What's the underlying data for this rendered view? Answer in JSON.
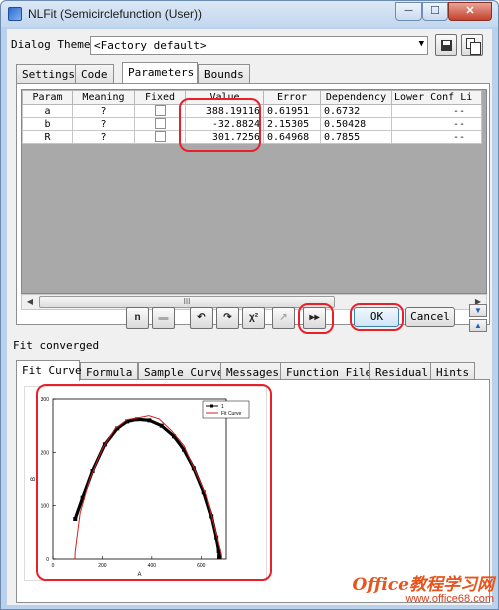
{
  "window": {
    "title": "NLFit (Semicirclefunction (User))",
    "controls": [
      "minimize-icon",
      "maximize-icon",
      "close-icon"
    ]
  },
  "theme": {
    "label": "Dialog Theme",
    "value": "<Factory default>"
  },
  "top_tabs": [
    {
      "label": "Settings",
      "active": false
    },
    {
      "label": "Code",
      "active": false
    },
    {
      "label": "Parameters",
      "active": true
    },
    {
      "label": "Bounds",
      "active": false
    }
  ],
  "params_table": {
    "headers": [
      "Param",
      "Meaning",
      "Fixed",
      "Value",
      "Error",
      "Dependency",
      "Lower Conf Li"
    ],
    "rows": [
      {
        "param": "a",
        "meaning": "?",
        "fixed": false,
        "value": "388.19116",
        "error": "0.61951",
        "dependency": "0.6732",
        "lcl": "--"
      },
      {
        "param": "b",
        "meaning": "?",
        "fixed": false,
        "value": "-32.8824",
        "error": "2.15305",
        "dependency": "0.50428",
        "lcl": "--"
      },
      {
        "param": "R",
        "meaning": "?",
        "fixed": false,
        "value": "301.7256",
        "error": "0.64968",
        "dependency": "0.7855",
        "lcl": "--"
      }
    ]
  },
  "scrollbar": {
    "thumb_glyph": "III"
  },
  "toolbar": {
    "buttons": [
      {
        "name": "iterations-icon",
        "glyph": "n",
        "enabled": true
      },
      {
        "name": "save-icon",
        "glyph": "▬",
        "enabled": false
      },
      {
        "name": "undo-icon",
        "glyph": "↶",
        "enabled": true
      },
      {
        "name": "redo-icon",
        "glyph": "↷",
        "enabled": true
      },
      {
        "name": "chi-square-icon",
        "glyph": "χ²",
        "enabled": true
      },
      {
        "name": "one-iteration-icon",
        "glyph": "↗",
        "enabled": false
      },
      {
        "name": "fit-till-converge-icon",
        "glyph": "▸▸",
        "enabled": true
      }
    ],
    "ok_label": "OK",
    "cancel_label": "Cancel"
  },
  "status": "Fit converged",
  "bottom_tabs": [
    {
      "label": "Fit Curve",
      "active": true
    },
    {
      "label": "Formula",
      "active": false
    },
    {
      "label": "Sample Curve",
      "active": false
    },
    {
      "label": "Messages",
      "active": false
    },
    {
      "label": "Function File",
      "active": false
    },
    {
      "label": "Residual",
      "active": false
    },
    {
      "label": "Hints",
      "active": false
    }
  ],
  "chart_data": {
    "type": "line",
    "xlabel": "A",
    "ylabel": "B",
    "xlim": [
      0,
      700
    ],
    "ylim": [
      0,
      300
    ],
    "xticks": [
      "0",
      "200",
      "400",
      "600"
    ],
    "yticks": [
      "0",
      "100",
      "200",
      "300"
    ],
    "legend": {
      "position": "top-right",
      "entries": [
        "1",
        "Fit Curve"
      ]
    },
    "series": [
      {
        "name": "1",
        "style": "black-square-markers",
        "color": "#000000",
        "x": [
          90,
          120,
          160,
          210,
          260,
          300,
          340,
          390,
          440,
          490,
          530,
          570,
          610,
          640,
          660,
          670,
          672,
          672
        ],
        "y": [
          75,
          115,
          165,
          215,
          245,
          258,
          262,
          260,
          250,
          230,
          205,
          170,
          125,
          80,
          40,
          15,
          5,
          0
        ]
      },
      {
        "name": "Fit Curve",
        "style": "solid-line",
        "color": "#d32020",
        "x": [
          86.47,
          90,
          110,
          150,
          200,
          250,
          300,
          350,
          388.19,
          430,
          480,
          530,
          580,
          620,
          660,
          680,
          689.9
        ],
        "y": [
          -32.88,
          13.1,
          86.1,
          151.2,
          206.8,
          244.1,
          261.3,
          265.4,
          268.8,
          262.6,
          240.7,
          212.9,
          161.0,
          120.4,
          46.1,
          9.9,
          -28.1
        ]
      }
    ]
  },
  "annotations": {
    "color": "#e8202a"
  },
  "watermark": {
    "line1": "Office教程学习网",
    "line2": "www.office68.com"
  }
}
